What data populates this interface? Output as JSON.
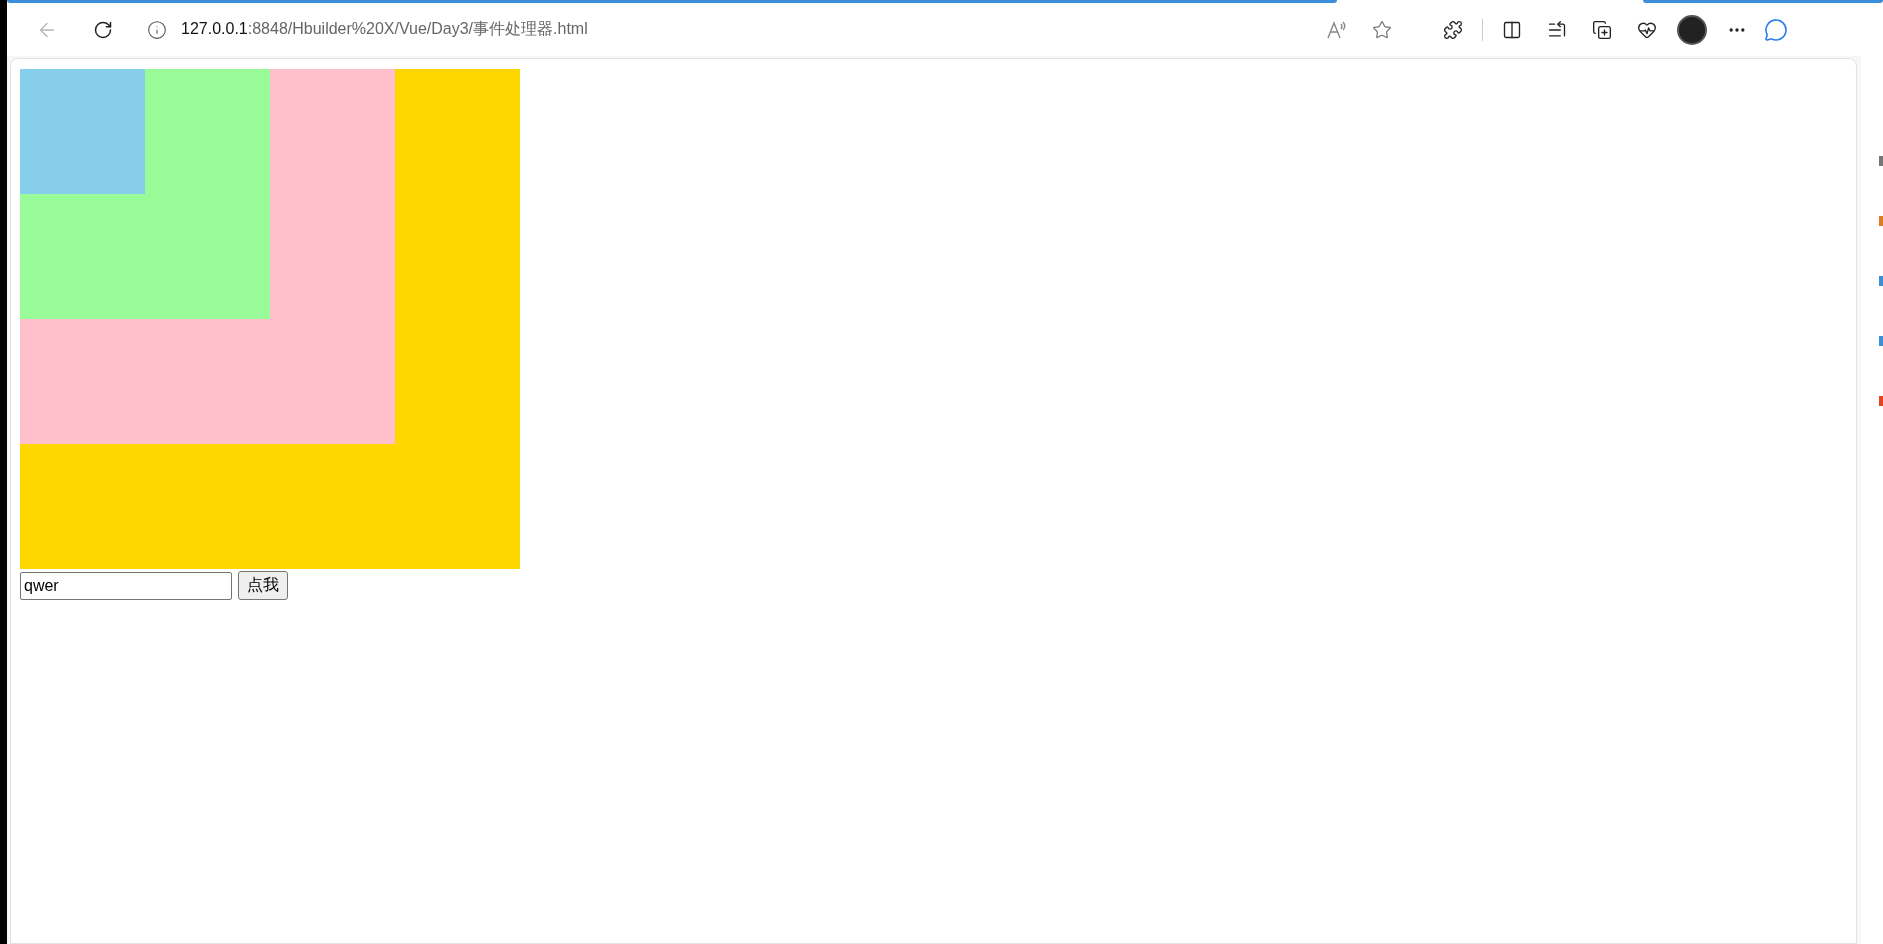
{
  "address_bar": {
    "host": "127.0.0.1",
    "path": ":8848/Hbuilder%20X/Vue/Day3/事件处理器.html"
  },
  "boxes": [
    {
      "color": "#ffd700"
    },
    {
      "color": "#ffc0cb"
    },
    {
      "color": "#98fb98"
    },
    {
      "color": "#87ceeb"
    }
  ],
  "text_input": {
    "value": "qwer"
  },
  "button": {
    "label": "点我"
  }
}
